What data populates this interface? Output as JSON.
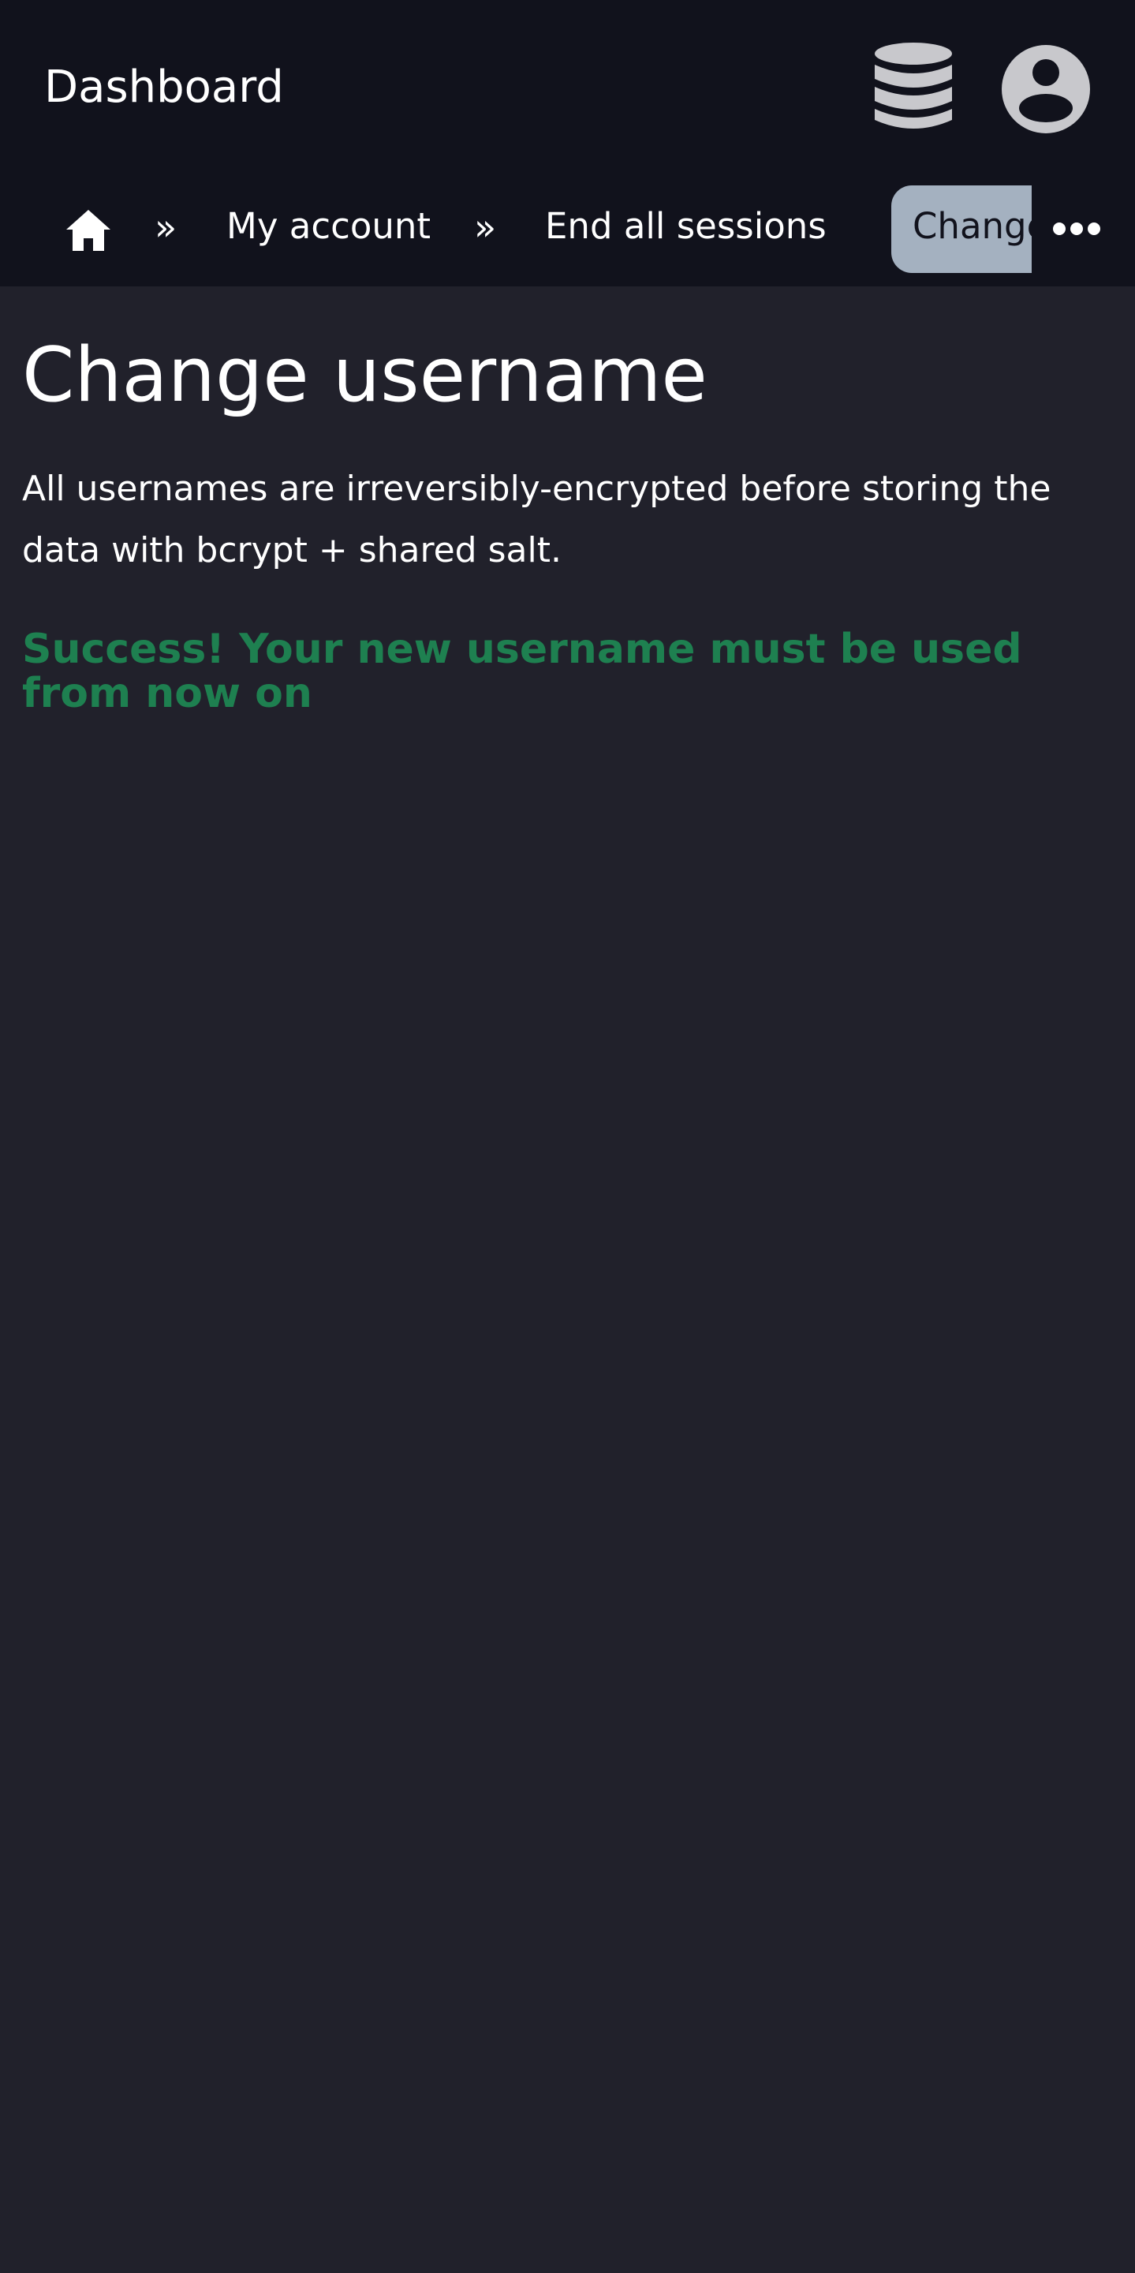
{
  "header": {
    "title": "Dashboard",
    "icons": {
      "database": "database-icon",
      "user": "user-avatar-icon"
    }
  },
  "breadcrumb": {
    "home_icon": "home-icon",
    "separator": "»",
    "items": [
      {
        "label": "My account"
      },
      {
        "label": "End all sessions"
      },
      {
        "label": "Change username",
        "active": true
      }
    ],
    "more_icon": "more-horizontal-icon"
  },
  "main": {
    "title": "Change username",
    "description": "All usernames are irreversibly-encrypted before storing the data with bcrypt + shared salt.",
    "success_message": "Success! Your new username must be used from now on"
  },
  "colors": {
    "header_bg": "#11121c",
    "page_bg": "#21212b",
    "active_crumb_bg": "#a4b1c0",
    "success": "#1e8050",
    "icon_gray": "#c8c8cc"
  }
}
